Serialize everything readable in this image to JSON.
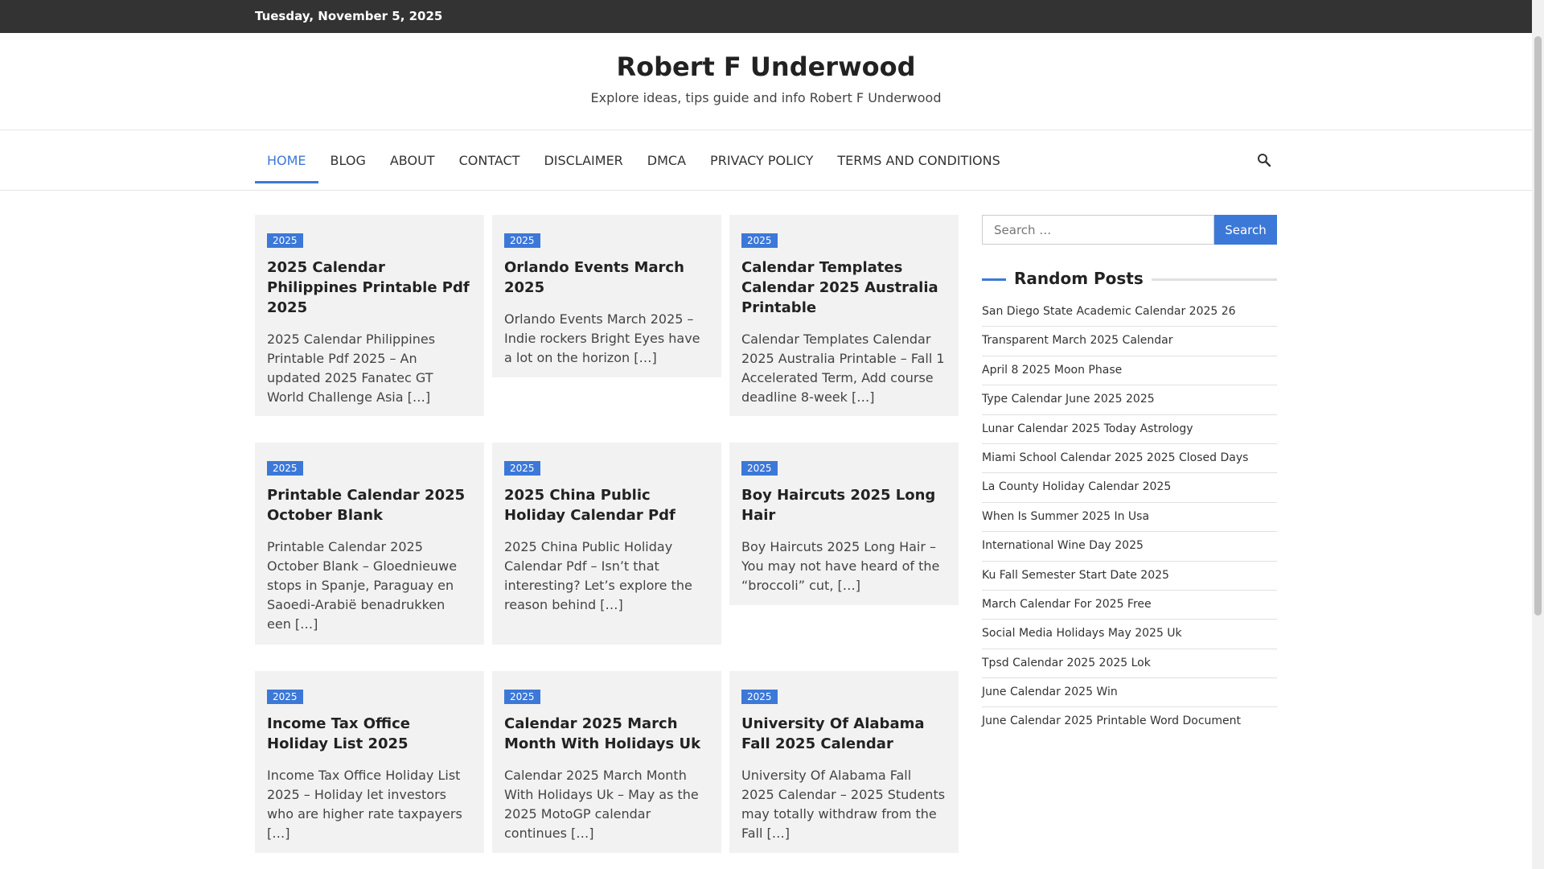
{
  "topbar": {
    "date": "Tuesday, November 5, 2025"
  },
  "site": {
    "title": "Robert F Underwood",
    "description": "Explore ideas, tips guide and info Robert F Underwood"
  },
  "nav": {
    "items": [
      "HOME",
      "BLOG",
      "ABOUT",
      "CONTACT",
      "DISCLAIMER",
      "DMCA",
      "PRIVACY POLICY",
      "TERMS AND CONDITIONS"
    ],
    "active": "HOME",
    "search_icon": "search-icon"
  },
  "posts": [
    {
      "category": "2025",
      "title": "2025 Calendar Philippines Printable Pdf 2025",
      "excerpt": "2025 Calendar Philippines Printable Pdf 2025 – An updated 2025 Fanatec GT World Challenge Asia […]"
    },
    {
      "category": "2025",
      "title": "Orlando Events March 2025",
      "excerpt": "Orlando Events March 2025 – Indie rockers Bright Eyes have a lot on the horizon […]"
    },
    {
      "category": "2025",
      "title": "Calendar Templates Calendar 2025 Australia Printable",
      "excerpt": "Calendar Templates Calendar 2025 Australia Printable – Fall 1 Accelerated Term, Add course deadline 8-week […]"
    },
    {
      "category": "2025",
      "title": "Printable Calendar 2025 October Blank",
      "excerpt": "Printable Calendar 2025 October Blank – Gloednieuwe stops in Spanje, Paraguay en Saoedi-Arabië benadrukken een […]"
    },
    {
      "category": "2025",
      "title": "2025 China Public Holiday Calendar Pdf",
      "excerpt": "2025 China Public Holiday Calendar Pdf – Isn’t that interesting? Let’s explore the reason behind […]"
    },
    {
      "category": "2025",
      "title": "Boy Haircuts 2025 Long Hair",
      "excerpt": "Boy Haircuts 2025 Long Hair – You may not have heard of the “broccoli” cut, […]"
    },
    {
      "category": "2025",
      "title": "Income Tax Office Holiday List 2025",
      "excerpt": "Income Tax Office Holiday List 2025 – Holiday let investors who are higher rate taxpayers […]"
    },
    {
      "category": "2025",
      "title": "Calendar 2025 March Month With Holidays Uk",
      "excerpt": "Calendar 2025 March Month With Holidays Uk – May as the 2025 MotoGP calendar continues […]"
    },
    {
      "category": "2025",
      "title": "University Of Alabama Fall 2025 Calendar",
      "excerpt": "University Of Alabama Fall 2025 Calendar – 2025 Students may totally withdraw from the Fall […]"
    }
  ],
  "sidebar": {
    "search": {
      "placeholder": "Search …",
      "button": "Search"
    },
    "random_posts_title": "Random Posts",
    "random_posts": [
      "San Diego State Academic Calendar 2025 26",
      "Transparent March 2025 Calendar",
      "April 8 2025 Moon Phase",
      "Type Calendar June 2025 2025",
      "Lunar Calendar 2025 Today Astrology",
      "Miami School Calendar 2025 2025 Closed Days",
      "La County Holiday Calendar 2025",
      "When Is Summer 2025 In Usa",
      "International Wine Day 2025",
      "Ku Fall Semester Start Date 2025",
      "March Calendar For 2025 Free",
      "Social Media Holidays May 2025 Uk",
      "Tpsd Calendar 2025 2025 Lok",
      "June Calendar 2025 Win",
      "June Calendar 2025 Printable Word Document"
    ]
  },
  "colors": {
    "accent": "#3c78d8",
    "topbar": "#333333",
    "card": "#f2f2f2"
  }
}
